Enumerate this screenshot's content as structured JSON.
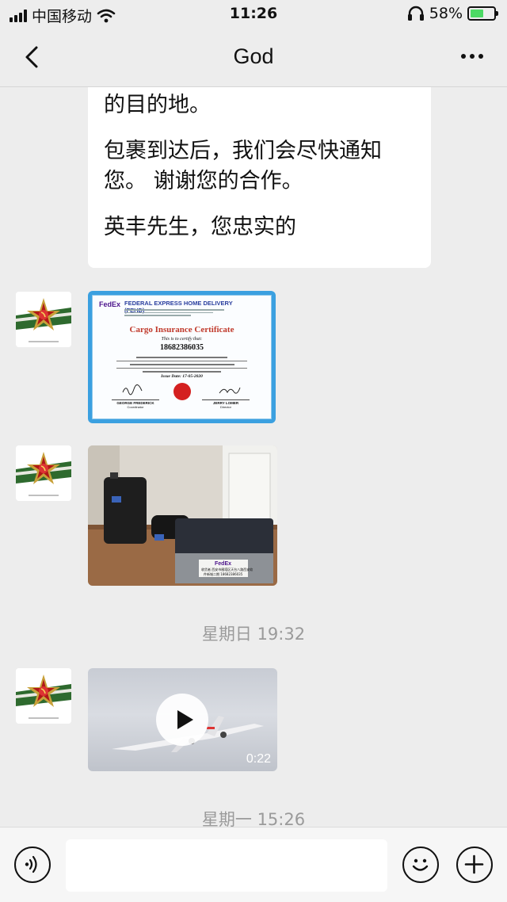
{
  "status_bar": {
    "carrier": "中国移动",
    "time": "11:26",
    "battery_percent": "58%",
    "battery_level": 0.58
  },
  "header": {
    "title": "God",
    "back_icon": "chevron-left-icon",
    "more_icon": "ellipsis-icon"
  },
  "messages": [
    {
      "type": "text",
      "paragraphs": [
        "的目的地。",
        "包裹到达后，我们会尽快通知您。 谢谢您的合作。",
        "英丰先生，您忠实的"
      ]
    },
    {
      "type": "image",
      "kind": "certificate",
      "certificate": {
        "logo": "FedEx",
        "title": "FEDERAL EXPRESS HOME DELIVERY (FEHD)",
        "heading": "Cargo Insurance Certificate",
        "certify_line": "This is to certify that:",
        "number": "18682386035",
        "issue_date": "Issue Date: 17-05-2020",
        "signer_left_name": "GEORGE FREDERICK",
        "signer_left_role": "Coordinator",
        "signer_right_name": "JERRY LOMER",
        "signer_right_role": "Director"
      }
    },
    {
      "type": "image",
      "kind": "photo",
      "box_label": "FedEx",
      "box_text_1": "收货者 西安市雁塔区天台八路西安软",
      "box_text_2": "件新城二期 18682386035"
    },
    {
      "type": "time",
      "label": "星期日 19:32"
    },
    {
      "type": "video",
      "duration": "0:22"
    },
    {
      "type": "time",
      "label": "星期一 15:26"
    }
  ],
  "input_bar": {
    "voice_icon": "voice-icon",
    "input_placeholder": "",
    "emoji_icon": "emoji-icon",
    "plus_icon": "plus-icon"
  },
  "colors": {
    "background": "#ededed",
    "bubble": "#ffffff",
    "battery_fill": "#4cd964",
    "cert_border": "#3ba0e0",
    "fedex_purple": "#4d148c",
    "fedex_orange": "#ff6600"
  }
}
